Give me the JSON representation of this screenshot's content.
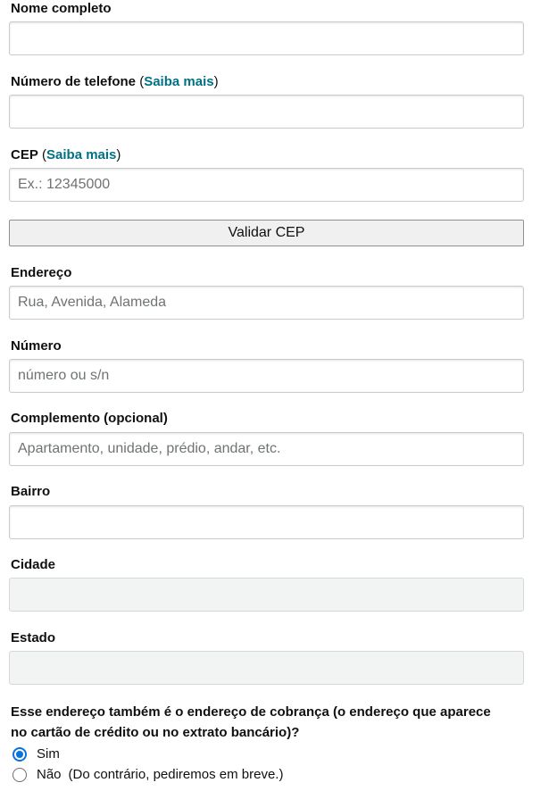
{
  "fields": {
    "full_name": {
      "label": "Nome completo",
      "value": ""
    },
    "phone": {
      "label": "Número de telefone",
      "open_paren": " (",
      "learn_more": "Saiba mais",
      "close_paren": ")",
      "value": ""
    },
    "cep": {
      "label": "CEP",
      "open_paren": " (",
      "learn_more": "Saiba mais",
      "close_paren": ")",
      "placeholder": "Ex.: 12345000",
      "value": ""
    },
    "validate_button": "Validar CEP",
    "address": {
      "label": "Endereço",
      "placeholder": "Rua, Avenida, Alameda",
      "value": ""
    },
    "number": {
      "label": "Número",
      "placeholder": "número ou s/n",
      "value": ""
    },
    "complement": {
      "label": "Complemento (opcional)",
      "placeholder": "Apartamento, unidade, prédio, andar, etc.",
      "value": ""
    },
    "neighborhood": {
      "label": "Bairro",
      "value": ""
    },
    "city": {
      "label": "Cidade",
      "value": ""
    },
    "state": {
      "label": "Estado",
      "value": ""
    }
  },
  "billing": {
    "question": "Esse endereço também é o endereço de cobrança (o endereço que aparece no cartão de crédito ou no extrato bancário)?",
    "options": [
      {
        "label": "Sim",
        "note": "",
        "selected": true
      },
      {
        "label": "Não",
        "note": "(Do contrário, pediremos em breve.)",
        "selected": false
      }
    ]
  },
  "colors": {
    "link": "#007185",
    "radio_selected": "#0a73d9",
    "disabled_field": "#f2f3f3"
  }
}
